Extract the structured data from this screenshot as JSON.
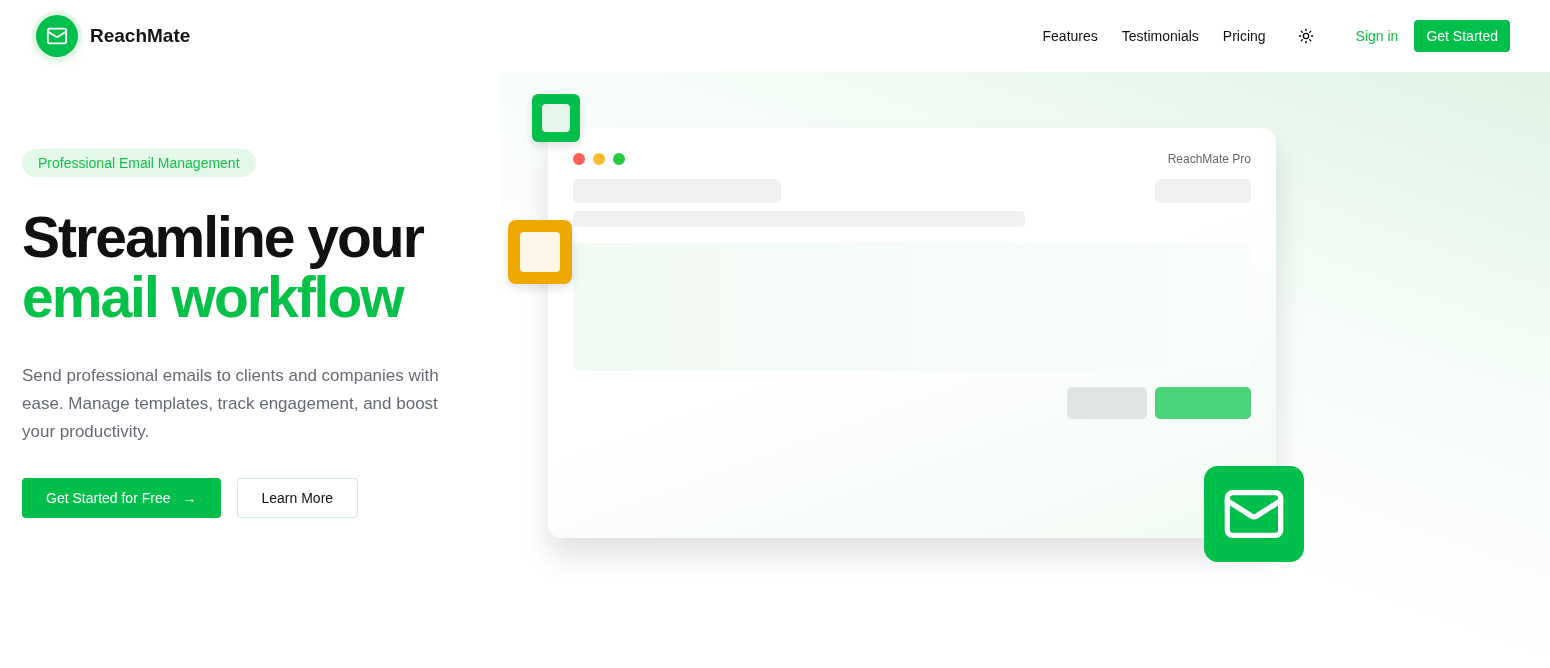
{
  "brand": {
    "name": "ReachMate"
  },
  "nav": {
    "links": [
      "Features",
      "Testimonials",
      "Pricing"
    ],
    "sign_in": "Sign in",
    "cta": "Get Started"
  },
  "hero": {
    "badge": "Professional Email Management",
    "title_line_1": "Streamline your",
    "title_line_2": "email workflow",
    "description": "Send professional emails to clients and companies with ease. Manage templates, track engagement, and boost your productivity.",
    "primary_button": "Get Started for Free",
    "primary_button_arrow": "→",
    "secondary_button": "Learn More"
  },
  "mockup": {
    "title": "ReachMate Pro",
    "window_dots": [
      {
        "color": "#ff5f57"
      },
      {
        "color": "#febc2e"
      },
      {
        "color": "#28c840"
      }
    ]
  }
}
